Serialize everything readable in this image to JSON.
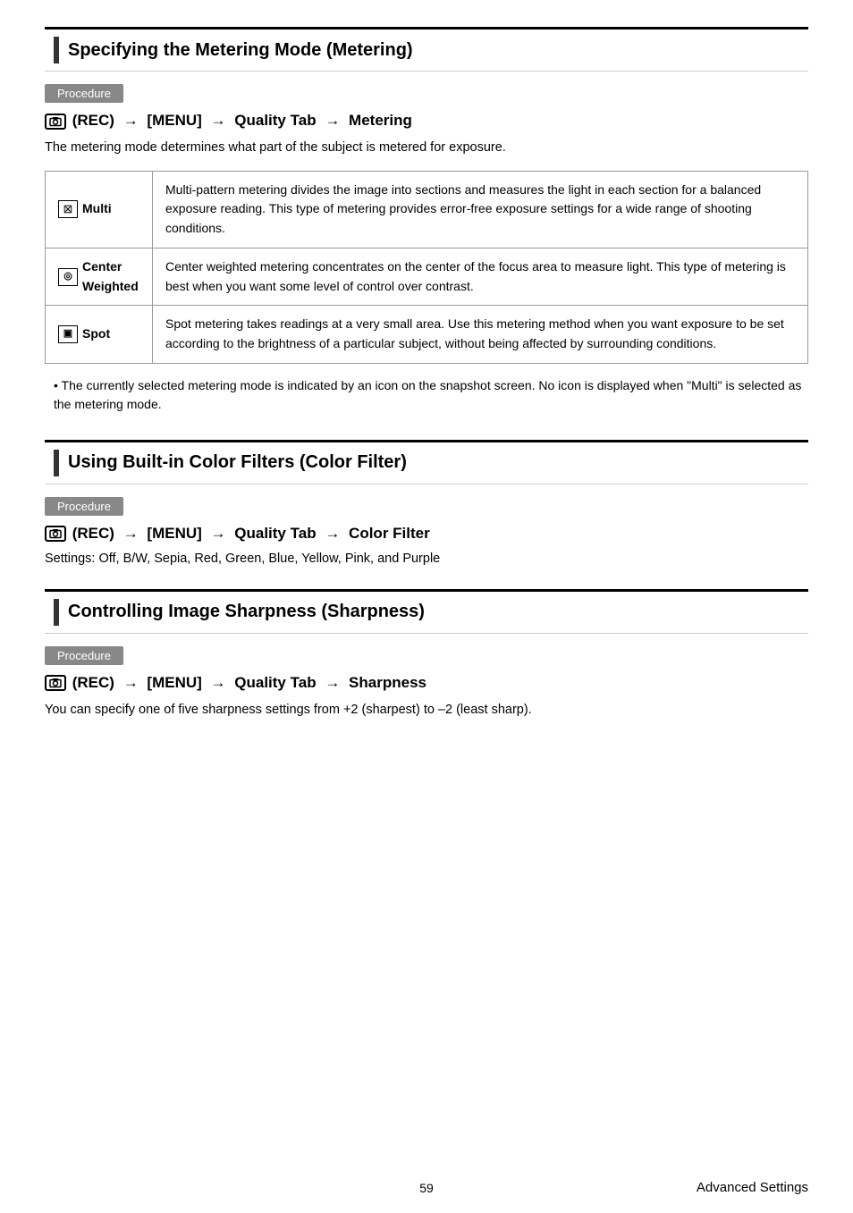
{
  "page": {
    "number": "59",
    "footer_label": "Advanced Settings"
  },
  "section1": {
    "title": "Specifying the Metering Mode (Metering)",
    "procedure_label": "Procedure",
    "path": "[■] (REC) → [MENU] → Quality Tab → Metering",
    "description": "The metering mode determines what part of the subject is metered for exposure.",
    "table": {
      "rows": [
        {
          "icon": "multi",
          "label": "Multi",
          "description": "Multi-pattern metering divides the image into sections and measures the light in each section for a balanced exposure reading. This type of metering provides error-free exposure settings for a wide range of shooting conditions."
        },
        {
          "icon": "center",
          "label": "Center\nWeighted",
          "description": "Center weighted metering concentrates on the center of the focus area to measure light. This type of metering is best when you want some level of control over contrast."
        },
        {
          "icon": "spot",
          "label": "Spot",
          "description": "Spot metering takes readings at a very small area. Use this metering method when you want exposure to be set according to the brightness of a particular subject, without being affected by surrounding conditions."
        }
      ]
    },
    "note": "The currently selected metering mode is indicated by an icon on the snapshot screen. No icon is displayed when \"Multi\" is selected as the metering mode."
  },
  "section2": {
    "title": "Using Built-in Color Filters (Color Filter)",
    "procedure_label": "Procedure",
    "path": "[■] (REC) → [MENU] → Quality Tab → Color Filter",
    "settings": "Settings: Off, B/W, Sepia, Red, Green, Blue, Yellow, Pink, and Purple"
  },
  "section3": {
    "title": "Controlling Image Sharpness (Sharpness)",
    "procedure_label": "Procedure",
    "path": "[■] (REC) → [MENU] → Quality Tab → Sharpness",
    "description": "You can specify one of five sharpness settings from +2 (sharpest) to –2 (least sharp)."
  }
}
